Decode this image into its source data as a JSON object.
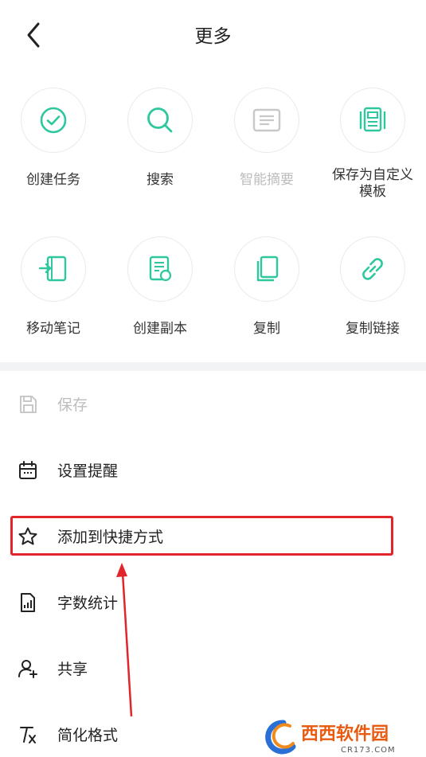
{
  "header": {
    "title": "更多"
  },
  "grid": [
    {
      "label": "创建任务",
      "icon": "check-circle-icon",
      "disabled": false
    },
    {
      "label": "搜索",
      "icon": "search-icon",
      "disabled": false
    },
    {
      "label": "智能摘要",
      "icon": "summary-icon",
      "disabled": true
    },
    {
      "label": "保存为自定义模板",
      "icon": "template-icon",
      "disabled": false
    },
    {
      "label": "移动笔记",
      "icon": "move-note-icon",
      "disabled": false
    },
    {
      "label": "创建副本",
      "icon": "duplicate-icon",
      "disabled": false
    },
    {
      "label": "复制",
      "icon": "copy-icon",
      "disabled": false
    },
    {
      "label": "复制链接",
      "icon": "link-icon",
      "disabled": false
    }
  ],
  "list": [
    {
      "label": "保存",
      "icon": "save-icon",
      "disabled": true
    },
    {
      "label": "设置提醒",
      "icon": "calendar-icon",
      "disabled": false
    },
    {
      "label": "添加到快捷方式",
      "icon": "star-icon",
      "disabled": false
    },
    {
      "label": "字数统计",
      "icon": "word-count-icon",
      "disabled": false
    },
    {
      "label": "共享",
      "icon": "share-user-icon",
      "disabled": false
    },
    {
      "label": "简化格式",
      "icon": "clear-format-icon",
      "disabled": false
    }
  ],
  "watermark": {
    "brand": "西西软件园",
    "site": "CR173.COM"
  },
  "colors": {
    "accent": "#2ec79e",
    "disabled": "#c8c8c8",
    "highlight": "#e1252b"
  }
}
